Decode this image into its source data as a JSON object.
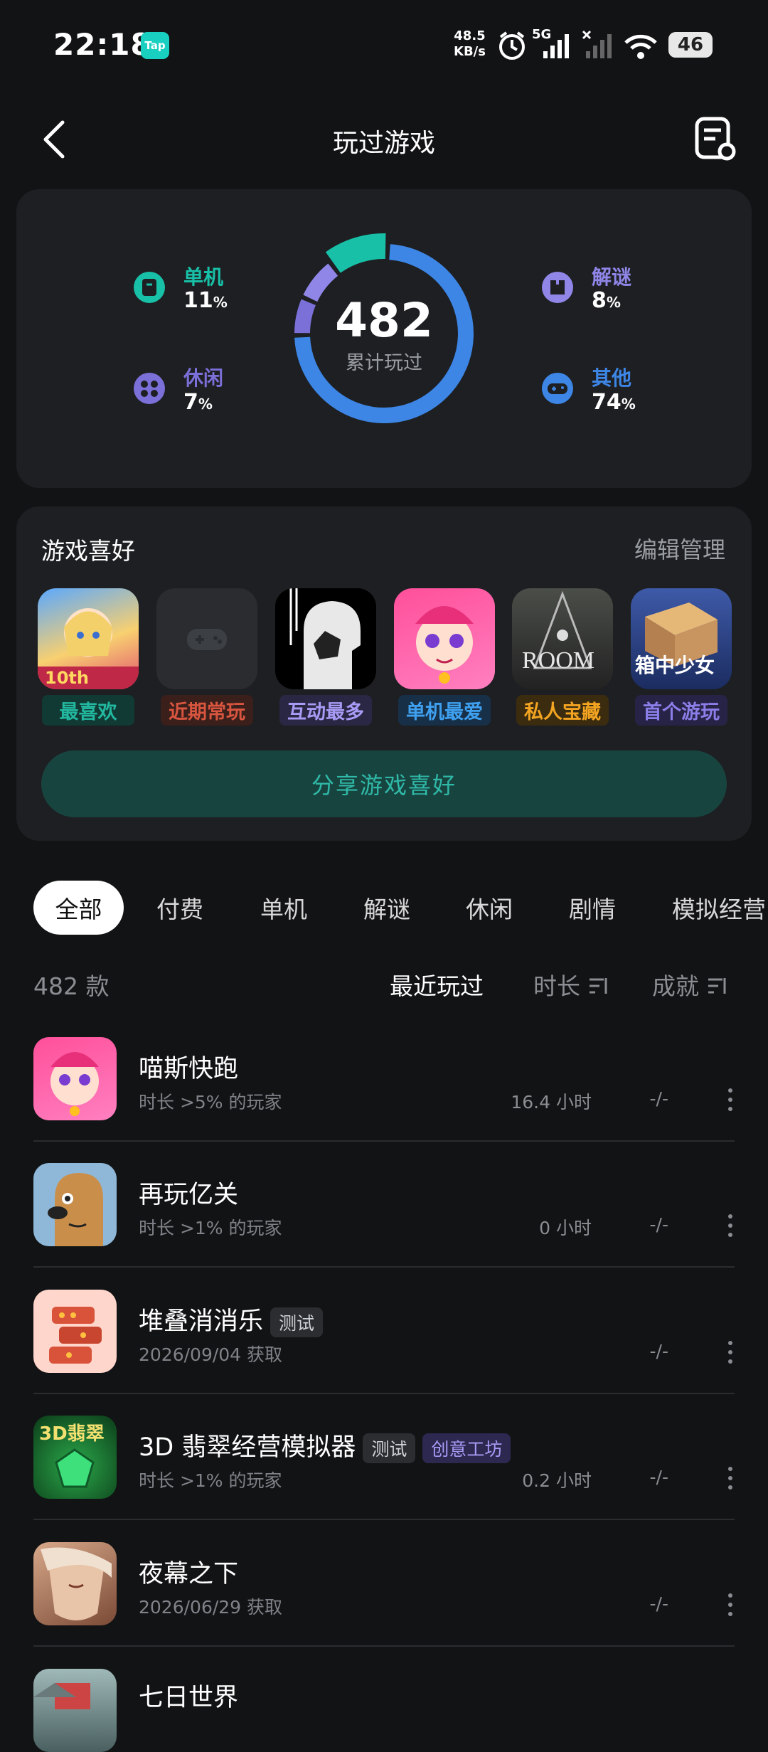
{
  "status": {
    "time": "22:18",
    "tap": "Tap",
    "speed_top": "48.5",
    "speed_unit": "KB/s",
    "network": "5G",
    "battery": "46"
  },
  "header": {
    "title": "玩过游戏"
  },
  "stats": {
    "total": "482",
    "total_label": "累计玩过",
    "categories": [
      {
        "name": "单机",
        "value": "11",
        "unit": "%",
        "color": "#18c0a8"
      },
      {
        "name": "休闲",
        "value": "7",
        "unit": "%",
        "color": "#7b6fd8"
      },
      {
        "name": "解谜",
        "value": "8",
        "unit": "%",
        "color": "#8f86e8"
      },
      {
        "name": "其他",
        "value": "74",
        "unit": "%",
        "color": "#3d86e6"
      }
    ]
  },
  "prefs": {
    "title": "游戏喜好",
    "edit": "编辑管理",
    "items": [
      {
        "tag": "最喜欢",
        "color": "#22b8a0",
        "bg": "#123a34"
      },
      {
        "tag": "近期常玩",
        "color": "#d8553f",
        "bg": "#3a1f1a"
      },
      {
        "tag": "互动最多",
        "color": "#a79bf5",
        "bg": "#2a2744"
      },
      {
        "tag": "单机最爱",
        "color": "#3fa0f0",
        "bg": "#173048"
      },
      {
        "tag": "私人宝藏",
        "color": "#f3a421",
        "bg": "#3b2c10"
      },
      {
        "tag": "首个游玩",
        "color": "#8b7ee8",
        "bg": "#262347"
      }
    ],
    "share": "分享游戏喜好"
  },
  "tabs": [
    "全部",
    "付费",
    "单机",
    "解谜",
    "休闲",
    "剧情",
    "模拟经营"
  ],
  "list_header": {
    "count": "482 款",
    "sort_recent": "最近玩过",
    "sort_time": "时长",
    "sort_ach": "成就"
  },
  "games": [
    {
      "name": "喵斯快跑",
      "sub": "时长 >5% 的玩家",
      "hours": "16.4 小时",
      "ach": "-/-",
      "chips": []
    },
    {
      "name": "再玩亿关",
      "sub": "时长 >1% 的玩家",
      "hours": "0 小时",
      "ach": "-/-",
      "chips": []
    },
    {
      "name": "堆叠消消乐",
      "sub": "2026/09/04 获取",
      "hours": "",
      "ach": "-/-",
      "chips": [
        "测试"
      ]
    },
    {
      "name": "3D 翡翠经营模拟器",
      "sub": "时长 >1% 的玩家",
      "hours": "0.2 小时",
      "ach": "-/-",
      "chips": [
        "测试",
        "创意工坊"
      ]
    },
    {
      "name": "夜幕之下",
      "sub": "2026/06/29 获取",
      "hours": "",
      "ach": "-/-",
      "chips": []
    },
    {
      "name": "七日世界",
      "sub": "",
      "hours": "",
      "ach": "",
      "chips": []
    }
  ]
}
